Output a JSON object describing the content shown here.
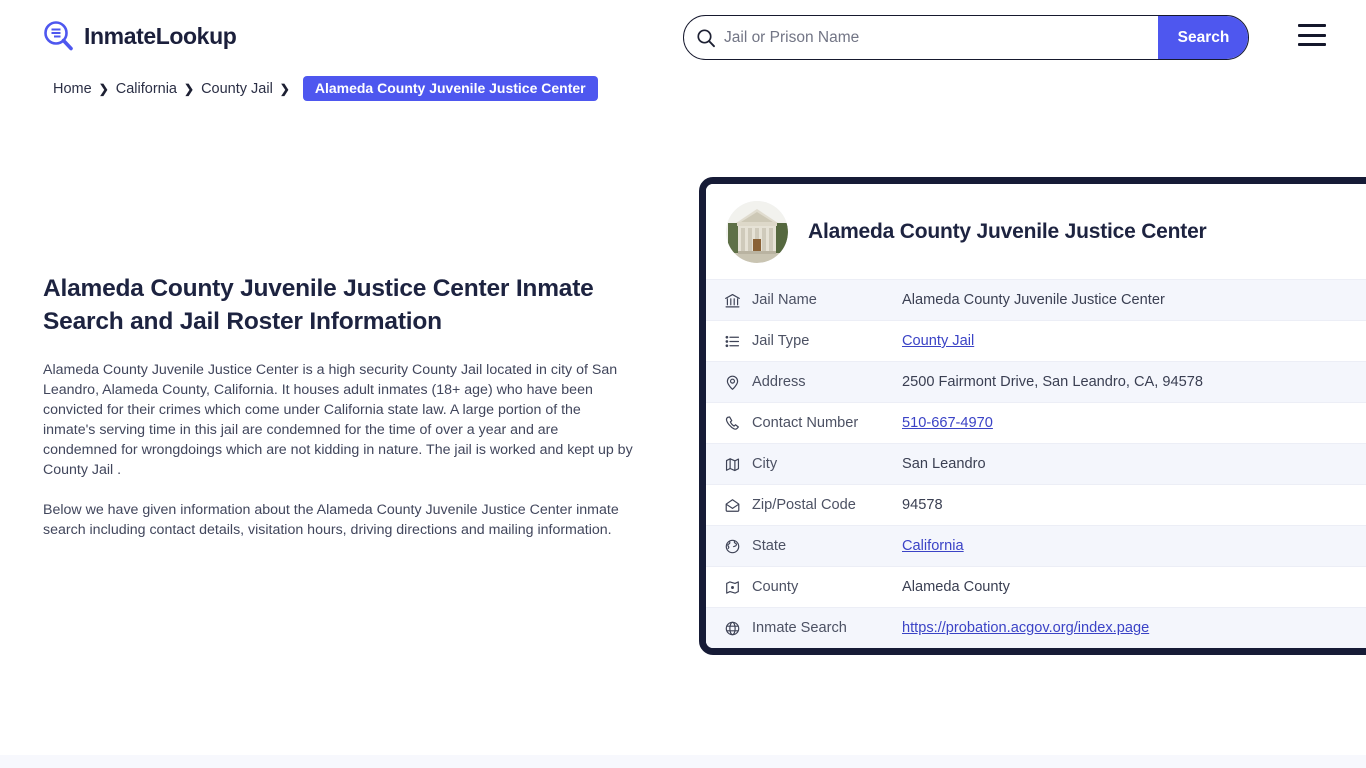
{
  "brand": {
    "name": "InmateLookup",
    "logo_icon": "magnifier-list-icon",
    "accent_color": "#4e57ef",
    "dark_color": "#161b36"
  },
  "search": {
    "placeholder": "Jail or Prison Name",
    "value": "",
    "button_label": "Search",
    "icon": "search-icon"
  },
  "menu": {
    "icon": "hamburger-menu-icon"
  },
  "breadcrumb": {
    "items": [
      {
        "label": "Home"
      },
      {
        "label": "California"
      },
      {
        "label": "County Jail"
      }
    ],
    "separator": "❯",
    "current": "Alameda County Juvenile Justice Center"
  },
  "main": {
    "title": "Alameda County Juvenile Justice Center Inmate Search and Jail Roster Information",
    "paragraphs": [
      "Alameda County Juvenile Justice Center is a high security County Jail located in city of San Leandro, Alameda County, California. It houses adult inmates (18+ age) who have been convicted for their crimes which come under California state law. A large portion of the inmate's serving time in this jail are condemned for the time of over a year and are condemned for wrongdoings which are not kidding in nature. The jail is worked and kept up by County Jail .",
      "Below we have given information about the Alameda County Juvenile Justice Center inmate search including contact details, visitation hours, driving directions and mailing information."
    ]
  },
  "card": {
    "avatar_icon": "courthouse-photo",
    "title": "Alameda County Juvenile Justice Center",
    "rows": [
      {
        "icon": "bank-icon",
        "label": "Jail Name",
        "value": "Alameda County Juvenile Justice Center",
        "link": false
      },
      {
        "icon": "list-icon",
        "label": "Jail Type",
        "value": "County Jail",
        "link": true
      },
      {
        "icon": "map-pin-icon",
        "label": "Address",
        "value": "2500 Fairmont Drive, San Leandro, CA, 94578",
        "link": false
      },
      {
        "icon": "phone-icon",
        "label": "Contact Number",
        "value": "510-667-4970",
        "link": true
      },
      {
        "icon": "map-icon",
        "label": "City",
        "value": "San Leandro",
        "link": false
      },
      {
        "icon": "envelope-icon",
        "label": "Zip/Postal Code",
        "value": "94578",
        "link": false
      },
      {
        "icon": "globe-americas-icon",
        "label": "State",
        "value": "California",
        "link": true
      },
      {
        "icon": "county-map-icon",
        "label": "County",
        "value": "Alameda County",
        "link": false
      },
      {
        "icon": "globe-icon",
        "label": "Inmate Search",
        "value": "https://probation.acgov.org/index.page",
        "link": true
      }
    ]
  }
}
